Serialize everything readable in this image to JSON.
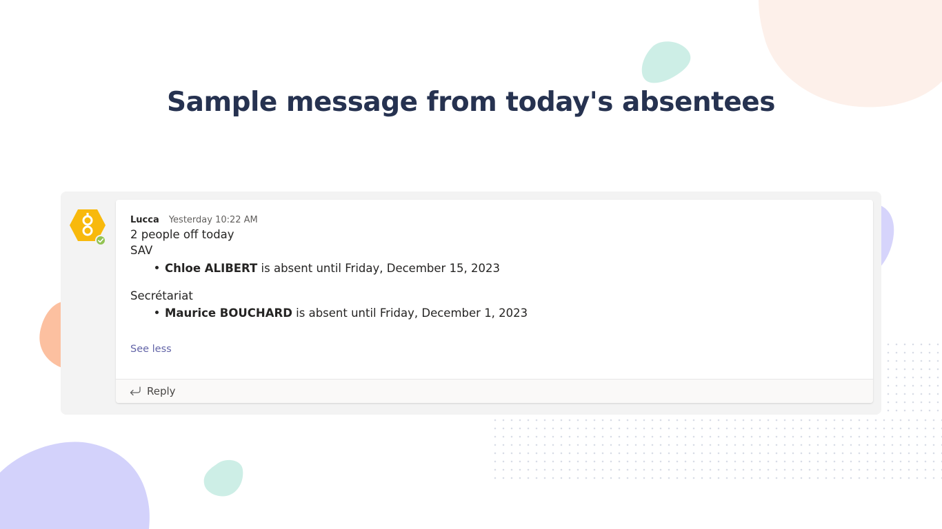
{
  "page": {
    "headline": "Sample message from today's absentees"
  },
  "message": {
    "sender": "Lucca",
    "timestamp": "Yesterday 10:22 AM",
    "summary": "2 people off today",
    "groups": [
      {
        "name": "SAV",
        "entries": [
          {
            "person": "Chloe ALIBERT",
            "status": "is absent until Friday, December 15, 2023"
          }
        ]
      },
      {
        "name": "Secrétariat",
        "entries": [
          {
            "person": "Maurice BOUCHARD",
            "status": "is absent until Friday, December 1, 2023"
          }
        ]
      }
    ],
    "see_less_label": "See less",
    "reply_label": "Reply"
  },
  "icons": {
    "avatar": "lucca-bot-avatar-icon",
    "presence": "available-check-icon",
    "reply": "reply-arrow-icon"
  },
  "colors": {
    "headline": "#263250",
    "link": "#6264a7",
    "avatar": "#f8b90c",
    "presence": "#92c353",
    "panel_bg": "#f3f3f3"
  }
}
